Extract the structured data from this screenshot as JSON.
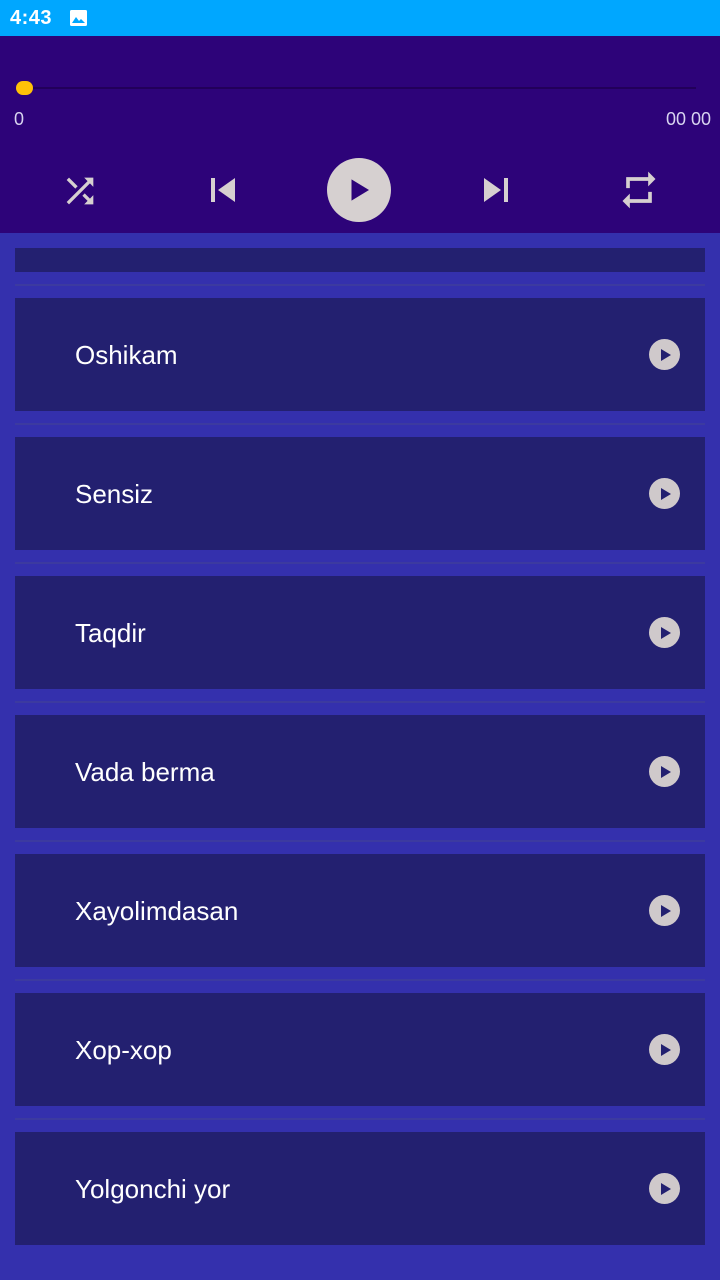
{
  "status_bar": {
    "time": "4:43",
    "notification_icon": "image-icon",
    "background": "#00a7ff"
  },
  "player": {
    "background": "#2d0379",
    "progress": 0,
    "current_time": "0",
    "total_time": "00 00",
    "seek_color": "#ffc107",
    "controls": {
      "shuffle_icon": "shuffle-icon",
      "previous_icon": "skip-previous-icon",
      "play_icon": "play-icon",
      "next_icon": "skip-next-icon",
      "repeat_icon": "repeat-icon"
    }
  },
  "songs": [
    {
      "title": "Oshikam"
    },
    {
      "title": "Sensiz"
    },
    {
      "title": "Taqdir"
    },
    {
      "title": "Vada berma"
    },
    {
      "title": "Xayolimdasan"
    },
    {
      "title": "Xop-xop"
    },
    {
      "title": "Yolgonchi yor"
    }
  ],
  "song_item_icon": "play-circle-icon",
  "colors": {
    "list_background": "#3430ad",
    "item_background": "#232070"
  }
}
